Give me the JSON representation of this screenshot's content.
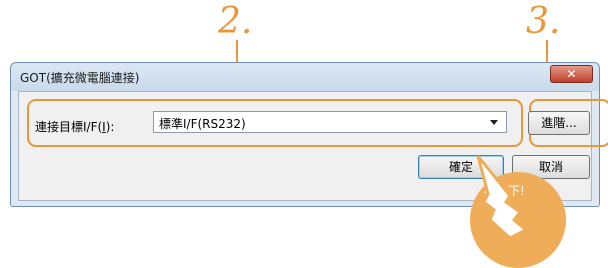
{
  "callouts": {
    "step2": "2.",
    "step3": "3."
  },
  "dialog": {
    "title": "GOT(擴充微電腦連接)",
    "close_glyph": "✕",
    "target_label": "連接目標I/F(",
    "target_label_hotkey": "I",
    "target_label_suffix": "):",
    "target_value": "標準I/F(RS232)",
    "advanced_button": "進階...",
    "ok_button": "確定",
    "cancel_button": "取消"
  },
  "hint": {
    "press_text": "按一下!"
  },
  "colors": {
    "accent": "#e8973a",
    "badge": "#efad5a",
    "close": "#c0412b"
  },
  "icons": [
    "close-icon",
    "chevron-down-icon",
    "pointing-hand-icon"
  ]
}
